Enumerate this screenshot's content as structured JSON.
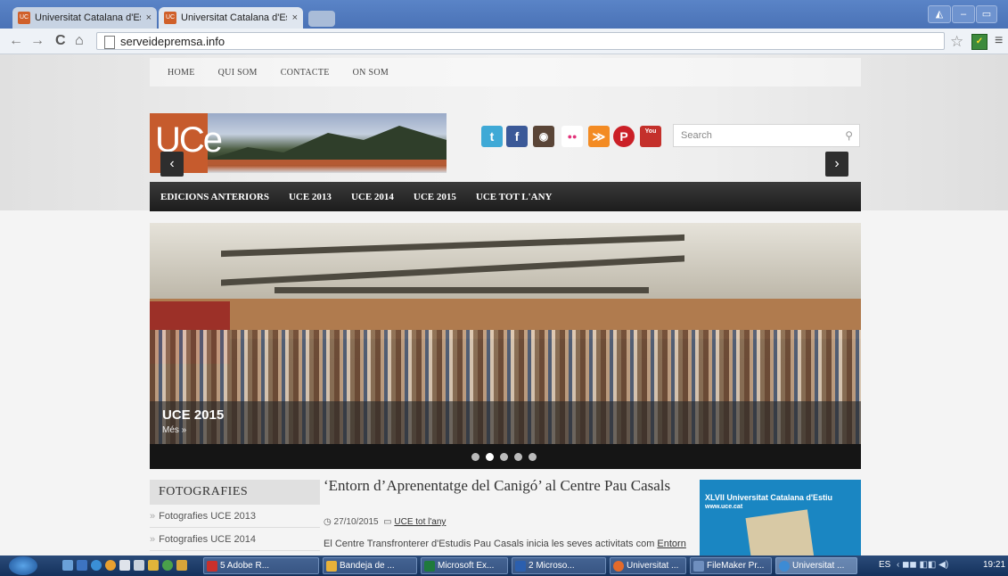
{
  "browser": {
    "tabs": [
      {
        "title": "Universitat Catalana d'Esti",
        "close": "×",
        "favicon": "UC"
      },
      {
        "title": "Universitat Catalana d'Esti",
        "close": "×",
        "favicon": "UC"
      }
    ],
    "url": "serveidepremsa.info",
    "back_icon": "←",
    "forward_icon": "→",
    "reload_icon": "C",
    "home_icon": "⌂",
    "star_icon": "☆",
    "menu_icon": "≡",
    "extension_icon": "✓"
  },
  "page": {
    "top_nav": [
      "HOME",
      "QUI SOM",
      "CONTACTE",
      "ON SOM"
    ],
    "logo_text": "UCe",
    "social_icons": [
      {
        "name": "twitter",
        "glyph": "t",
        "color": "#3fa9d6"
      },
      {
        "name": "facebook",
        "glyph": "f",
        "color": "#3b5998"
      },
      {
        "name": "instagram",
        "glyph": "◉",
        "color": "#5a4537"
      },
      {
        "name": "flickr",
        "glyph": "●●",
        "color": "#ffffff"
      },
      {
        "name": "rss",
        "glyph": "≫",
        "color": "#f38b23"
      },
      {
        "name": "pinterest",
        "glyph": "P",
        "color": "#cb2027"
      },
      {
        "name": "youtube",
        "glyph": "You",
        "color": "#c4302b"
      }
    ],
    "search_placeholder": "Search",
    "main_nav": [
      "EDICIONS ANTERIORS",
      "UCE 2013",
      "UCE 2014",
      "UCE 2015",
      "UCE TOT L'ANY"
    ],
    "slider": {
      "caption_title": "UCE 2015",
      "caption_more": "Més »",
      "prev": "‹",
      "next": "›",
      "dots": 5,
      "active_dot": 1
    },
    "sidebar": {
      "title": "FOTOGRAFIES",
      "links": [
        "Fotografies UCE 2013",
        "Fotografies UCE 2014"
      ]
    },
    "article": {
      "title": "‘Entorn d’Aprenentatge del Canigó’ al Centre Pau Casals",
      "date": "27/10/2015",
      "category": "UCE tot l'any",
      "excerpt_before": "El Centre Transfronterer d'Estudis Pau Casals inicia les seves activitats com ",
      "excerpt_link": "Entorn"
    },
    "ad": {
      "title": "XLVII Universitat Catalana d'Estiu",
      "url": "www.uce.cat"
    }
  },
  "taskbar": {
    "tasks": [
      {
        "label": "5 Adobe R...",
        "icon_color": "#c9302c"
      },
      {
        "label": "Bandeja de ...",
        "icon_color": "#e8b23a"
      },
      {
        "label": "Microsoft Ex...",
        "icon_color": "#1f7a3c"
      },
      {
        "label": "2 Microso...",
        "icon_color": "#2b5fae"
      },
      {
        "label": "Universitat ...",
        "icon_color": "#e46a2a"
      },
      {
        "label": "FileMaker Pr...",
        "icon_color": "#6f8fbf"
      },
      {
        "label": "Universitat ...",
        "icon_color": "#3d8bd4"
      }
    ],
    "lang": "ES",
    "clock": "19:21"
  }
}
